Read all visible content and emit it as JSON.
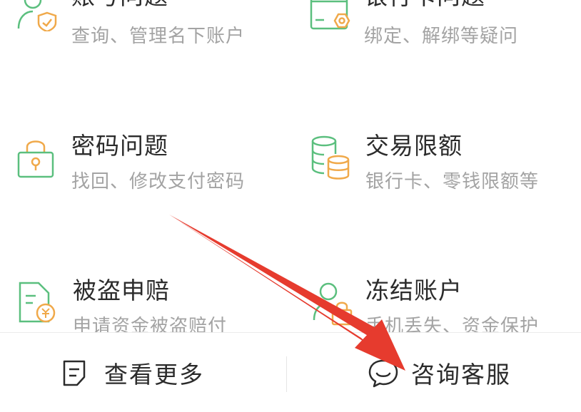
{
  "colors": {
    "green": "#5bbf7e",
    "orange": "#f0a94a",
    "arrow": "#e63b2e"
  },
  "menu": [
    {
      "title": "账号问题",
      "desc": "查询、管理名下账户",
      "icon": "user-shield-icon"
    },
    {
      "title": "银行卡问题",
      "desc": "绑定、解绑等疑问",
      "icon": "bank-card-icon"
    },
    {
      "title": "密码问题",
      "desc": "找回、修改支付密码",
      "icon": "lock-icon"
    },
    {
      "title": "交易限额",
      "desc": "银行卡、零钱限额等",
      "icon": "coin-stack-icon"
    },
    {
      "title": "被盗申赔",
      "desc": "申请资金被盗赔付",
      "icon": "claim-document-icon"
    },
    {
      "title": "冻结账户",
      "desc": "手机丢失、资金保护",
      "icon": "user-lock-icon"
    }
  ],
  "footer": {
    "more_label": "查看更多",
    "more_icon": "document-icon",
    "service_label": "咨询客服",
    "service_icon": "chat-bubble-icon"
  }
}
